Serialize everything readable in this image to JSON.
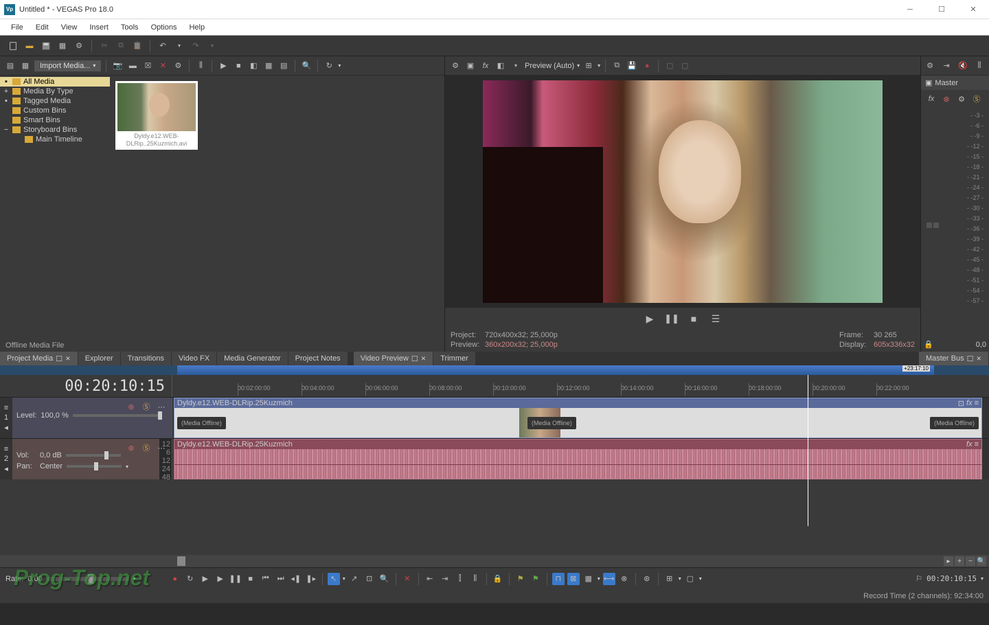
{
  "window": {
    "title": "Untitled * - VEGAS Pro 18.0"
  },
  "menu": [
    "File",
    "Edit",
    "View",
    "Insert",
    "Tools",
    "Options",
    "Help"
  ],
  "media_panel": {
    "import_btn": "Import Media...",
    "tree": [
      {
        "label": "All Media",
        "selected": true
      },
      {
        "label": "Media By Type"
      },
      {
        "label": "Tagged Media"
      },
      {
        "label": "Custom Bins"
      },
      {
        "label": "Smart Bins"
      },
      {
        "label": "Storyboard Bins"
      },
      {
        "label": "Main Timeline",
        "indent": true
      }
    ],
    "thumb_caption": "Dyldy.e12.WEB-DLRip..25Kuzmich.avi",
    "status": "Offline Media File"
  },
  "preview": {
    "mode": "Preview (Auto)",
    "info": {
      "project_lbl": "Project:",
      "project_val": "720x400x32; 25,000p",
      "preview_lbl": "Preview:",
      "preview_val": "360x200x32; 25,000p",
      "frame_lbl": "Frame:",
      "frame_val": "30 265",
      "display_lbl": "Display:",
      "display_val": "605x336x32"
    }
  },
  "tabs_left": [
    "Project Media",
    "Explorer",
    "Transitions",
    "Video FX",
    "Media Generator",
    "Project Notes"
  ],
  "tabs_right": [
    "Video Preview",
    "Trimmer"
  ],
  "master": {
    "title": "Master",
    "ticks": [
      "-3",
      "-6",
      "-9",
      "-12",
      "-15",
      "-18",
      "-21",
      "-24",
      "-27",
      "-30",
      "-33",
      "-36",
      "-39",
      "-42",
      "-45",
      "-48",
      "-51",
      "-54",
      "-57"
    ],
    "foot_val": "0,0",
    "tab": "Master Bus"
  },
  "timeline": {
    "time": "00:20:10:15",
    "end_marker": "+23:17:10",
    "ruler": [
      "00:02:00:00",
      "00:04:00:00",
      "00:06:00:00",
      "00:08:00:00",
      "00:10:00:00",
      "00:12:00:00",
      "00:14:00:00",
      "00:16:00:00",
      "00:18:00:00",
      "00:20:00:00",
      "00:22:00:00"
    ],
    "track1": {
      "num": "1",
      "level_lbl": "Level:",
      "level_val": "100,0 %",
      "clip_name": "Dyldy.e12.WEB-DLRip.25Kuzmich",
      "offline": "(Media Offline)"
    },
    "track2": {
      "num": "2",
      "vol_lbl": "Vol:",
      "vol_val": "0,0 dB",
      "pan_lbl": "Pan:",
      "pan_val": "Center",
      "clip_name": "Dyldy.e12.WEB-DLRip.25Kuzmich",
      "scale": [
        "12",
        "6",
        "12",
        "24",
        "48"
      ]
    }
  },
  "bottombar": {
    "rate_lbl": "Rate:",
    "rate_val": "0,00",
    "time": "00:20:10:15"
  },
  "statusbar": {
    "record": "Record Time (2 channels): 92:34:00"
  },
  "watermark": "Prog-Top.net"
}
